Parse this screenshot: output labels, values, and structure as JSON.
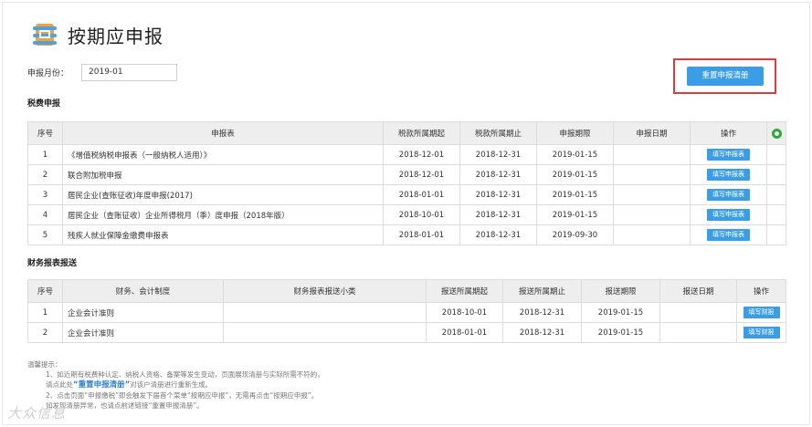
{
  "page": {
    "title": "按期应申报"
  },
  "month": {
    "label": "申报月份：",
    "value": "2019-01"
  },
  "reset_button": {
    "label": "重置申报清册"
  },
  "tax_section": {
    "title": "税费申报",
    "headers": [
      "序号",
      "申报表",
      "税款所属期起",
      "税款所属期止",
      "申报期限",
      "申报日期",
      "操作"
    ],
    "rows": [
      {
        "no": "1",
        "form": "《增值税纳税申报表（一般纳税人适用）》",
        "start": "2018-12-01",
        "end": "2018-12-31",
        "deadline": "2019-01-15",
        "date": "",
        "action": "填写申报表"
      },
      {
        "no": "2",
        "form": "联合附加税申报",
        "start": "2018-12-01",
        "end": "2018-12-31",
        "deadline": "2019-01-15",
        "date": "",
        "action": "填写申报表"
      },
      {
        "no": "3",
        "form": "居民企业(查账征收)年度申报(2017)",
        "start": "2018-01-01",
        "end": "2018-12-31",
        "deadline": "2019-01-15",
        "date": "",
        "action": "填写申报表"
      },
      {
        "no": "4",
        "form": "居民企业（查账征收）企业所得税月（季）度申报（2018年版）",
        "start": "2018-10-01",
        "end": "2018-12-31",
        "deadline": "2019-01-15",
        "date": "",
        "action": "填写申报表"
      },
      {
        "no": "5",
        "form": "残疾人就业保障金缴费申报表",
        "start": "2018-01-01",
        "end": "2018-12-31",
        "deadline": "2019-09-30",
        "date": "",
        "action": "填写申报表"
      }
    ]
  },
  "finance_section": {
    "title": "财务报表报送",
    "headers": [
      "序号",
      "财务、会计制度",
      "财务报表报送小类",
      "报送所属期起",
      "报送所属期止",
      "报送期限",
      "报送日期",
      "操作"
    ],
    "rows": [
      {
        "no": "1",
        "system": "企业会计准则",
        "subtype": "",
        "start": "2018-10-01",
        "end": "2018-12-31",
        "deadline": "2019-01-15",
        "date": "",
        "action": "填写财报"
      },
      {
        "no": "2",
        "system": "企业会计准则",
        "subtype": "",
        "start": "2018-01-01",
        "end": "2018-12-31",
        "deadline": "2019-01-15",
        "date": "",
        "action": "填写财报"
      }
    ]
  },
  "tips": {
    "title": "温馨提示：",
    "line1": "1、如近期有税费种认定、纳税人资格、备案等发生变动，页面展现清册与实际所需不符的，",
    "line2_pre": "请点此处",
    "line2_link": "“重置申报清册”",
    "line2_post": "对该户清册进行重新生成。",
    "line3": "2、点击页面“申报缴税”即会触发下届首个菜单“按期应申报”，无需再点击“按期应申报”。",
    "line4": "如发现清册异常，也请点前述链接“重置申报清册”。"
  },
  "watermark": "大众信息"
}
